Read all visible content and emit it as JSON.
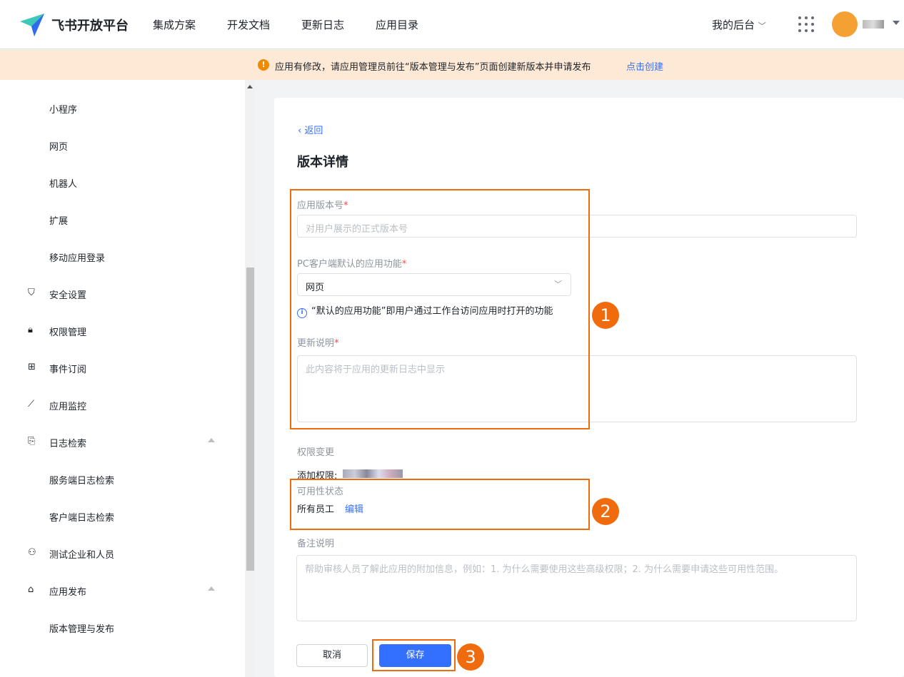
{
  "header": {
    "brand": "飞书开放平台",
    "nav": [
      "集成方案",
      "开发文档",
      "更新日志",
      "应用目录"
    ],
    "my_console": "我的后台"
  },
  "banner": {
    "message": "应用有修改，请应用管理员前往“版本管理与发布”页面创建新版本并申请发布",
    "link": "点击创建"
  },
  "sidebar": {
    "items": [
      {
        "label": "小程序",
        "icon": ""
      },
      {
        "label": "网页",
        "icon": ""
      },
      {
        "label": "机器人",
        "icon": ""
      },
      {
        "label": "扩展",
        "icon": ""
      },
      {
        "label": "移动应用登录",
        "icon": ""
      },
      {
        "label": "安全设置",
        "icon": "shield-icon"
      },
      {
        "label": "权限管理",
        "icon": "lock-icon"
      },
      {
        "label": "事件订阅",
        "icon": "plus-box-icon"
      },
      {
        "label": "应用监控",
        "icon": "chart-icon"
      },
      {
        "label": "日志检索",
        "icon": "search-doc-icon"
      },
      {
        "label": "服务端日志检索",
        "icon": ""
      },
      {
        "label": "客户端日志检索",
        "icon": ""
      },
      {
        "label": "测试企业和人员",
        "icon": "users-icon"
      },
      {
        "label": "应用发布",
        "icon": "store-icon"
      },
      {
        "label": "版本管理与发布",
        "icon": ""
      }
    ]
  },
  "form": {
    "back": "返回",
    "title": "版本详情",
    "version_label": "应用版本号",
    "version_placeholder": "对用户展示的正式版本号",
    "pc_label": "PC客户端默认的应用功能",
    "pc_value": "网页",
    "pc_hint": "“默认的应用功能”即用户通过工作台访问应用时打开的功能",
    "notes_label": "更新说明",
    "notes_placeholder": "此内容将于应用的更新日志中显示",
    "perm_label": "权限变更",
    "perm_add": "添加权限:",
    "avail_label": "可用性状态",
    "avail_value": "所有员工",
    "avail_edit": "编辑",
    "remark_label": "备注说明",
    "remark_placeholder": "帮助审核人员了解此应用的附加信息，例如：1. 为什么需要使用这些高级权限；2. 为什么需要申请这些可用性范围。",
    "cancel": "取消",
    "save": "保存",
    "required": "*"
  },
  "annotations": [
    "1",
    "2",
    "3"
  ],
  "colors": {
    "accent": "#3370ff",
    "annotation": "#f06b0e"
  }
}
